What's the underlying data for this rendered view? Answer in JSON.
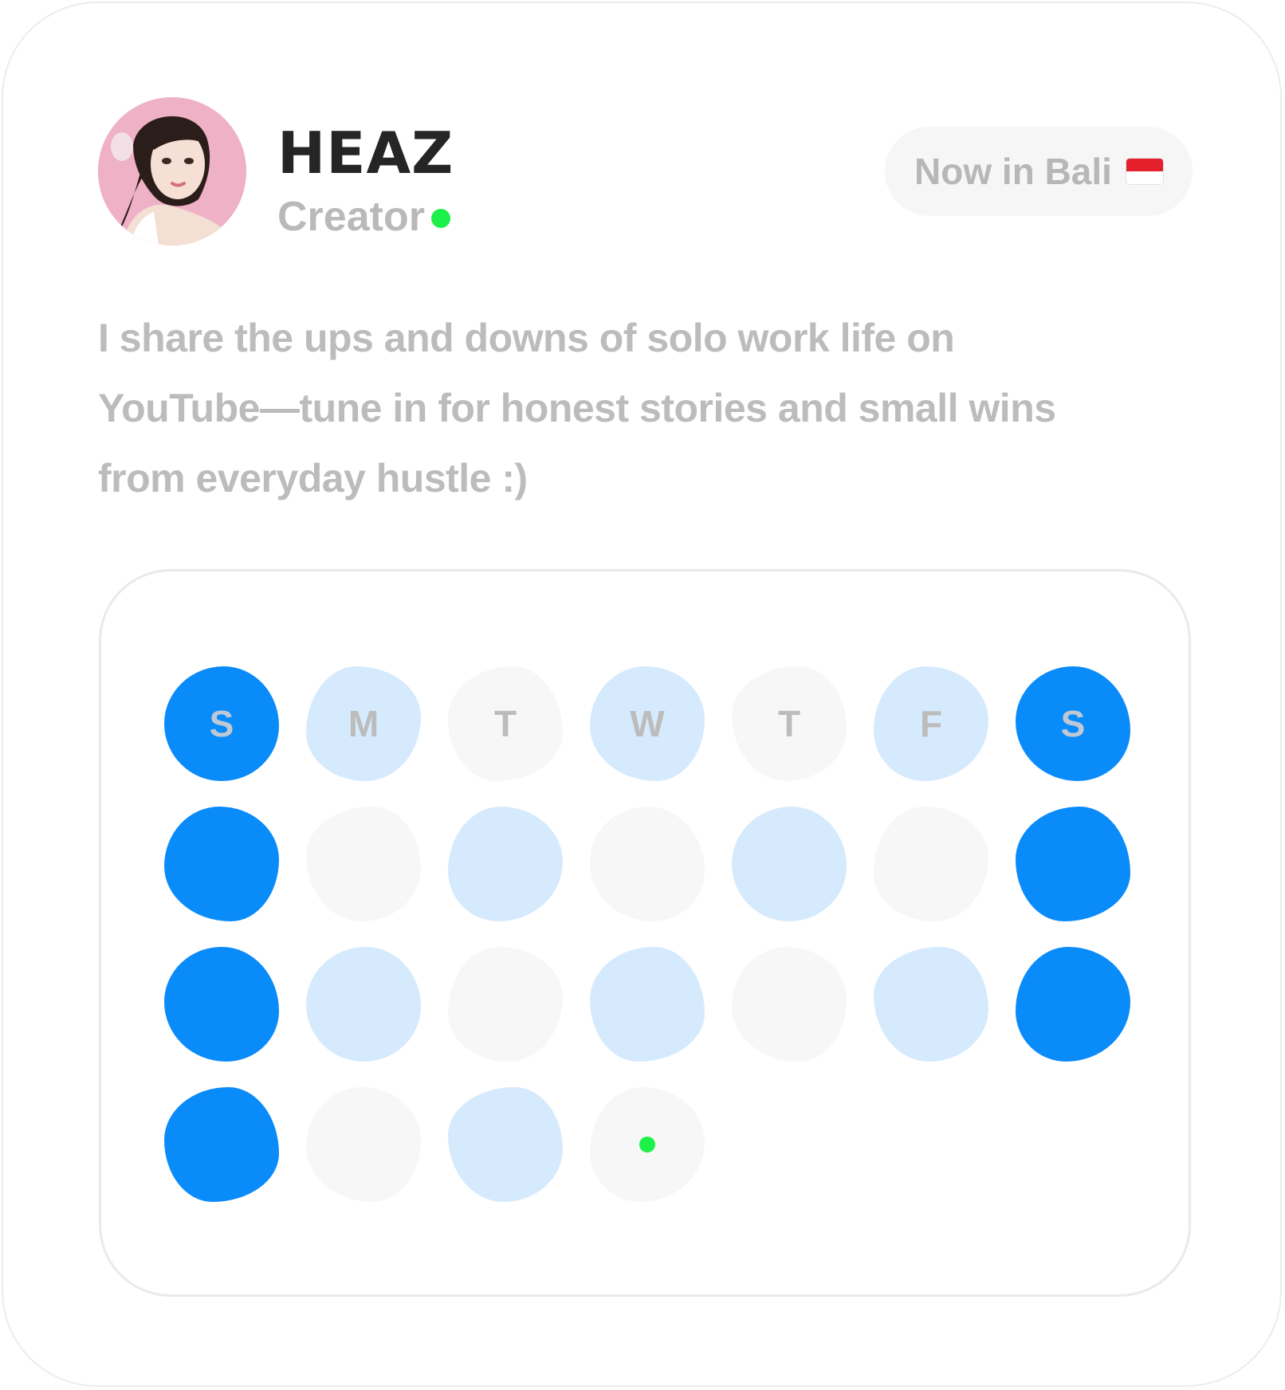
{
  "profile": {
    "name": "HEAZ",
    "role": "Creator",
    "status": "online",
    "avatar_icon": "avatar-photo"
  },
  "location": {
    "label": "Now in Bali",
    "flag_icon": "indonesia-flag-icon"
  },
  "bio": " I share the ups and downs of solo work life on\nYouTube—tune in for honest stories and small wins\nfrom everyday hustle :)",
  "calendar": {
    "weekday_labels": [
      "S",
      "M",
      "T",
      "W",
      "T",
      "F",
      "S"
    ],
    "rows": [
      [
        "strong",
        "light",
        "empty",
        "light",
        "empty",
        "light",
        "strong"
      ],
      [
        "strong",
        "empty",
        "light",
        "empty",
        "light",
        "empty",
        "strong"
      ],
      [
        "strong",
        "light",
        "empty",
        "light",
        "empty",
        "light",
        "strong"
      ],
      [
        "strong",
        "empty",
        "light",
        "today"
      ]
    ],
    "colors": {
      "strong": "#0a8bfa",
      "light": "#d6eafd",
      "empty": "#f7f7f7",
      "online": "#1ef04a"
    }
  }
}
